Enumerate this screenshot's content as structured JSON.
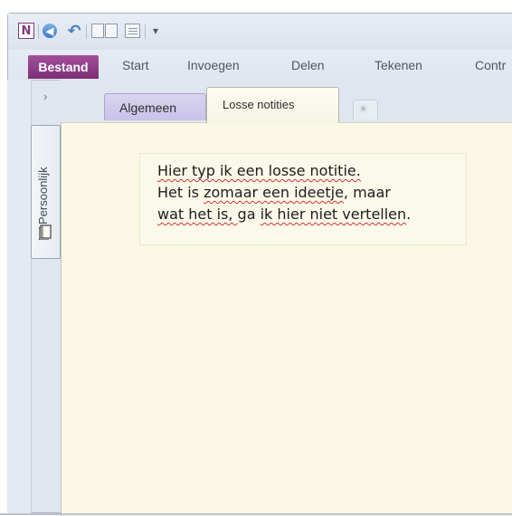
{
  "qat": {
    "app_icon_letter": "N",
    "more": "▾"
  },
  "ribbon": {
    "tabs": [
      "Bestand",
      "Start",
      "Invoegen",
      "Delen",
      "Tekenen",
      "Contr"
    ]
  },
  "notebook": {
    "expand_arrow": "›",
    "name": "Persoonlijk"
  },
  "sections": {
    "tabs": [
      "Algemeen",
      "Losse notities"
    ],
    "new_tab_icon": "✳"
  },
  "note": {
    "lines": [
      [
        {
          "text": "Hier typ ik een losse notitie.",
          "squiggle": true
        }
      ],
      [
        {
          "text": "Het is ",
          "squiggle": false
        },
        {
          "text": "zomaar een ideetje",
          "squiggle": true
        },
        {
          "text": ", maar",
          "squiggle": false
        }
      ],
      [
        {
          "text": "wat het is, ",
          "squiggle": true
        },
        {
          "text": "ga ",
          "squiggle": false
        },
        {
          "text": "ik hier niet vertellen",
          "squiggle": true
        },
        {
          "text": ".",
          "squiggle": false
        }
      ]
    ]
  },
  "colors": {
    "bestand_tab": "#80397b",
    "page_background": "#fbf8e6",
    "spell_squiggle": "#d23232",
    "algemeen_tab": "#c9c2e8"
  }
}
